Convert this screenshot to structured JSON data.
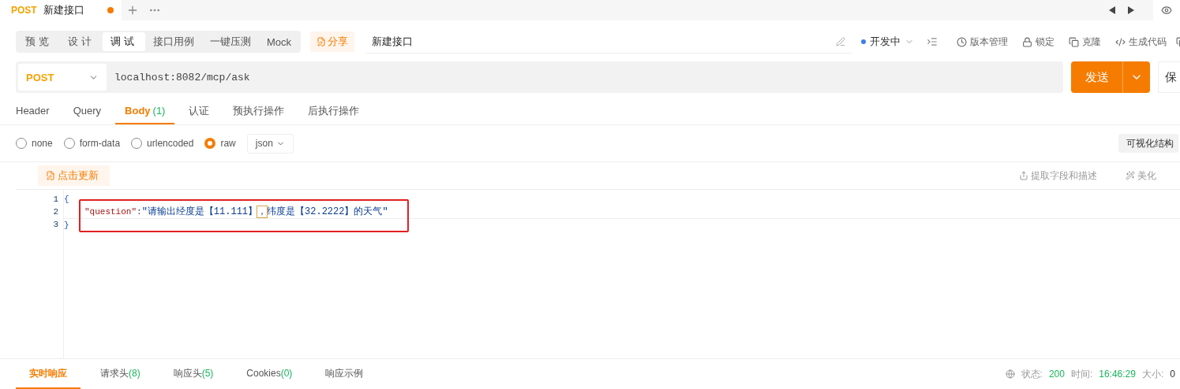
{
  "tabs": [
    {
      "method": "POST",
      "title": "新建接口",
      "selected": true,
      "unsaved": true
    }
  ],
  "mode_tabs": [
    {
      "label": "预览",
      "selected": false
    },
    {
      "label": "设计",
      "selected": false
    },
    {
      "label": "调试",
      "selected": true
    },
    {
      "label": "接口用例",
      "selected": false
    },
    {
      "label": "一键压测",
      "selected": false
    },
    {
      "label": "Mock",
      "selected": false
    }
  ],
  "share_button": "分享",
  "api_name": "新建接口",
  "status": {
    "label": "开发中",
    "color": "#3b7ded"
  },
  "toolbar": [
    {
      "label": "版本管理",
      "kind": "history"
    },
    {
      "label": "锁定",
      "kind": "lock"
    },
    {
      "label": "克隆",
      "kind": "clone"
    },
    {
      "label": "生成代码",
      "kind": "code"
    }
  ],
  "request": {
    "method": "POST",
    "url": "localhost:8082/mcp/ask",
    "send": "发送",
    "save": "保"
  },
  "param_tabs": [
    {
      "label": "Header",
      "selected": false
    },
    {
      "label": "Query",
      "selected": false
    },
    {
      "label": "Body",
      "count": "(1)",
      "selected": true
    },
    {
      "label": "认证",
      "selected": false
    },
    {
      "label": "预执行操作",
      "selected": false
    },
    {
      "label": "后执行操作",
      "selected": false
    }
  ],
  "body_types": [
    {
      "label": "none",
      "selected": false
    },
    {
      "label": "form-data",
      "selected": false
    },
    {
      "label": "urlencoded",
      "selected": false
    },
    {
      "label": "raw",
      "selected": true
    }
  ],
  "format": "json",
  "visual_button": "可视化结构",
  "editor": {
    "update_button": "点击更新",
    "actions": [
      {
        "label": "提取字段和描述",
        "kind": "extract"
      },
      {
        "label": "美化",
        "kind": "beautify"
      }
    ],
    "lines": [
      {
        "number": "1",
        "indent": false,
        "highlighted": false,
        "tokens": [
          {
            "kind": "brace",
            "text": "{"
          }
        ]
      },
      {
        "number": "2",
        "indent": true,
        "highlighted": true,
        "tokens": [
          {
            "kind": "key",
            "text": "\"question\""
          },
          {
            "kind": "punct",
            "text": ":"
          },
          {
            "kind": "string",
            "text": "\"请输出经度是【11.111】"
          },
          {
            "kind": "cursor",
            "text": "，"
          },
          {
            "kind": "string",
            "text": "纬度是【32.2222】的天气\""
          }
        ]
      },
      {
        "number": "3",
        "indent": false,
        "highlighted": false,
        "tokens": [
          {
            "kind": "brace",
            "text": "}"
          }
        ]
      }
    ]
  },
  "response_tabs": [
    {
      "label": "实时响应",
      "selected": true
    },
    {
      "label": "请求头",
      "count": "(8)",
      "selected": false
    },
    {
      "label": "响应头",
      "count": "(5)",
      "selected": false
    },
    {
      "label": "Cookies",
      "count": "(0)",
      "selected": false
    },
    {
      "label": "响应示例",
      "selected": false
    }
  ],
  "status_bar": {
    "status_label": "状态:",
    "status": "200",
    "time_label": "时间:",
    "time": "16:46:29",
    "size_label": "大小:",
    "size": "0"
  }
}
